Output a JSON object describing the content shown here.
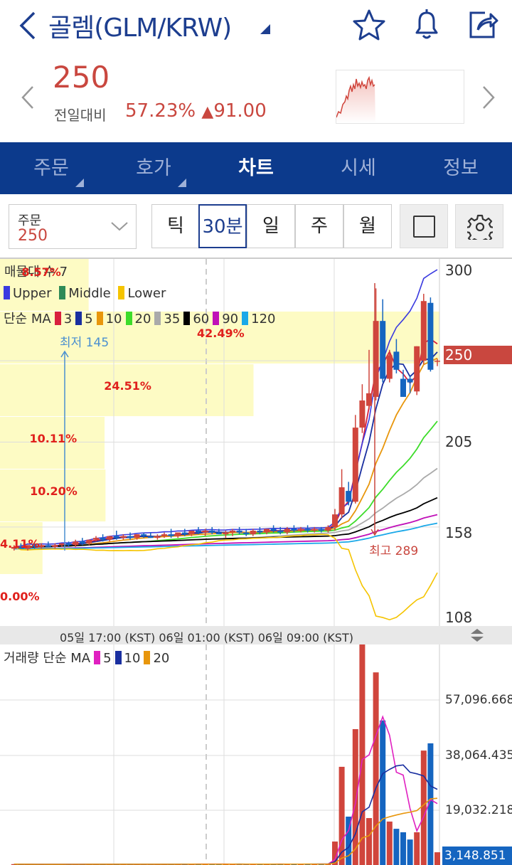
{
  "header": {
    "title": "골렘(GLM/KRW)"
  },
  "price": {
    "current": "250",
    "change_label": "전일대비",
    "change_pct": "57.23%",
    "change_arrow": "▲",
    "change_amt": "91.00"
  },
  "nav": {
    "tabs": [
      {
        "label": "주문"
      },
      {
        "label": "호가"
      },
      {
        "label": "차트"
      },
      {
        "label": "시세"
      },
      {
        "label": "정보"
      }
    ]
  },
  "toolbar": {
    "order_label": "주문",
    "order_value": "250",
    "periods": [
      "틱",
      "30분",
      "일",
      "주",
      "월"
    ],
    "selected_period": "30분"
  },
  "chart": {
    "profile_title": "매물대 수 7",
    "bb_legend": [
      "Upper",
      "Middle",
      "Lower"
    ],
    "ma_label": "단순 MA",
    "ma_periods": [
      "3",
      "5",
      "10",
      "20",
      "35",
      "60",
      "90",
      "120"
    ],
    "ma_colors": [
      "#d8203e",
      "#1a2fa0",
      "#e8960c",
      "#3ddc2a",
      "#aaaaaa",
      "#000000",
      "#c010b8",
      "#1aa8e8"
    ],
    "bb_colors": [
      "#3a3ae0",
      "#2e8b57",
      "#f5c400"
    ],
    "y_ticks": [
      "300",
      "205",
      "158",
      "108"
    ],
    "y_range": [
      108,
      300
    ],
    "current_tag": "250",
    "low_label": "최저 145",
    "high_label": "최고 289",
    "profile": [
      {
        "pct": "8.57%",
        "v": 8.57
      },
      {
        "pct": "42.49%",
        "v": 42.49
      },
      {
        "pct": "24.51%",
        "v": 24.51
      },
      {
        "pct": "10.11%",
        "v": 10.11
      },
      {
        "pct": "10.20%",
        "v": 10.2
      },
      {
        "pct": "4.11%",
        "v": 4.11
      },
      {
        "pct": "0.00%",
        "v": 0
      }
    ],
    "time_axis": "05일 17:00 (KST) 06일 01:00 (KST) 06일 09:00 (KST)",
    "candles": [
      [
        146,
        148,
        145,
        147
      ],
      [
        147,
        149,
        146,
        146
      ],
      [
        146,
        148,
        145,
        148
      ],
      [
        148,
        149,
        146,
        147
      ],
      [
        147,
        149,
        146,
        148
      ],
      [
        148,
        150,
        147,
        147
      ],
      [
        147,
        149,
        146,
        148
      ],
      [
        148,
        149,
        147,
        149
      ],
      [
        149,
        150,
        147,
        148
      ],
      [
        148,
        151,
        147,
        150
      ],
      [
        150,
        152,
        148,
        149
      ],
      [
        149,
        151,
        148,
        151
      ],
      [
        151,
        153,
        150,
        152
      ],
      [
        152,
        154,
        150,
        151
      ],
      [
        151,
        153,
        150,
        153
      ],
      [
        153,
        156,
        151,
        152
      ],
      [
        152,
        154,
        151,
        153
      ],
      [
        153,
        155,
        151,
        152
      ],
      [
        152,
        154,
        151,
        154
      ],
      [
        154,
        155,
        152,
        153
      ],
      [
        153,
        155,
        152,
        152
      ],
      [
        152,
        154,
        151,
        153
      ],
      [
        153,
        155,
        152,
        154
      ],
      [
        154,
        157,
        152,
        153
      ],
      [
        153,
        155,
        152,
        155
      ],
      [
        155,
        157,
        153,
        154
      ],
      [
        154,
        156,
        153,
        156
      ],
      [
        156,
        158,
        154,
        155
      ],
      [
        155,
        157,
        153,
        156
      ],
      [
        156,
        158,
        154,
        155
      ],
      [
        155,
        157,
        154,
        154
      ],
      [
        154,
        156,
        152,
        155
      ],
      [
        155,
        157,
        153,
        156
      ],
      [
        156,
        158,
        154,
        155
      ],
      [
        155,
        157,
        153,
        154
      ],
      [
        154,
        157,
        153,
        156
      ],
      [
        156,
        158,
        154,
        155
      ],
      [
        155,
        157,
        154,
        157
      ],
      [
        157,
        159,
        155,
        156
      ],
      [
        156,
        158,
        154,
        155
      ],
      [
        155,
        158,
        154,
        157
      ],
      [
        157,
        159,
        155,
        156
      ],
      [
        156,
        158,
        155,
        157
      ],
      [
        157,
        159,
        155,
        156
      ],
      [
        156,
        158,
        155,
        157
      ],
      [
        157,
        158,
        155,
        156
      ],
      [
        156,
        159,
        155,
        158
      ],
      [
        158,
        168,
        156,
        165
      ],
      [
        165,
        190,
        163,
        180
      ],
      [
        178,
        183,
        170,
        172
      ],
      [
        172,
        220,
        171,
        213
      ],
      [
        213,
        237,
        210,
        228
      ],
      [
        225,
        256,
        223,
        232
      ],
      [
        230,
        290,
        228,
        272
      ],
      [
        272,
        284,
        238,
        240
      ],
      [
        240,
        256,
        238,
        253
      ],
      [
        255,
        262,
        243,
        245
      ],
      [
        240,
        245,
        230,
        230
      ],
      [
        240,
        242,
        232,
        238
      ],
      [
        233,
        258,
        231,
        258
      ],
      [
        250,
        287,
        248,
        283
      ],
      [
        282,
        285,
        244,
        245
      ],
      [
        250,
        251,
        247,
        250
      ]
    ],
    "vol_ticks": [
      "57,096.668",
      "38,064.435",
      "19,032.218"
    ],
    "vol_current": "3,148.851",
    "vol_label": "거래량 단순 MA",
    "vol_ma_periods": [
      "5",
      "10",
      "20"
    ],
    "vol_ma_colors": [
      "#e020c0",
      "#1a2fa0",
      "#e8960c"
    ],
    "volumes": [
      300,
      200,
      250,
      180,
      300,
      220,
      200,
      260,
      300,
      240,
      280,
      350,
      300,
      260,
      240,
      300,
      280,
      260,
      220,
      300,
      250,
      280,
      300,
      260,
      350,
      300,
      280,
      400,
      320,
      300,
      260,
      280,
      300,
      340,
      280,
      300,
      320,
      300,
      350,
      300,
      280,
      320,
      300,
      340,
      300,
      320,
      400,
      8100,
      33900,
      16700,
      46900,
      76400,
      16200,
      66500,
      49900,
      15000,
      12500,
      11300,
      8800,
      11300,
      39500,
      42000,
      4400
    ],
    "vol_max": 76400
  }
}
